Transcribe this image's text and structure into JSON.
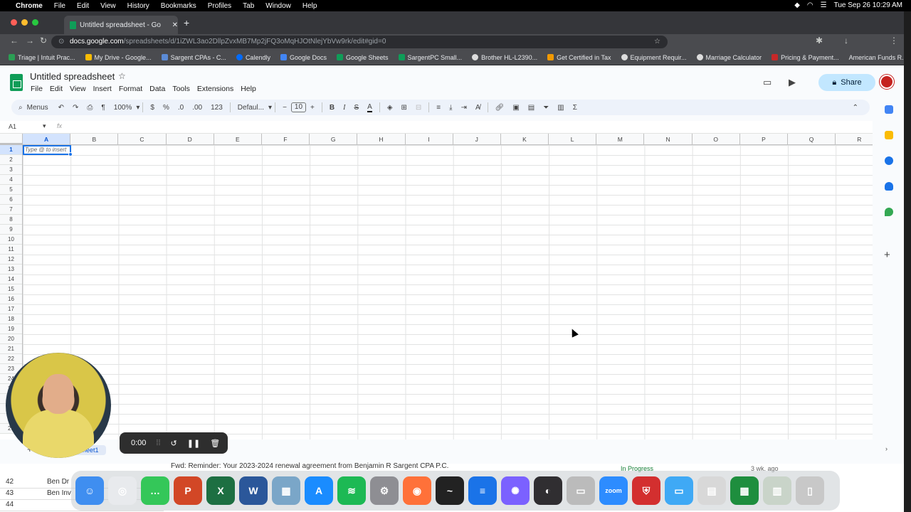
{
  "mac_menubar": {
    "app": "Chrome",
    "items": [
      "File",
      "Edit",
      "View",
      "History",
      "Bookmarks",
      "Profiles",
      "Tab",
      "Window",
      "Help"
    ],
    "clock": "Tue Sep 26  10:29 AM"
  },
  "browser": {
    "tab_title": "Untitled spreadsheet - Go",
    "url_host": "docs.google.com",
    "url_path": "/spreadsheets/d/1iZWL3ao2DllpZvxMB7Mp2jFQ3oMqHJOtNlejYbVw9rk/edit#gid=0",
    "bookmarks": [
      "Triage | Intuit Prac...",
      "My Drive - Google...",
      "Sargent CPAs - C...",
      "Calendly",
      "Google Docs",
      "Google Sheets",
      "SargentPC Small...",
      "Brother HL-L2390...",
      "Get Certified in Tax",
      "Equipment Requir...",
      "Marriage Calculator",
      "Pricing & Payment...",
      "American Funds R..."
    ]
  },
  "sheets": {
    "title": "Untitled spreadsheet",
    "menus": [
      "File",
      "Edit",
      "View",
      "Insert",
      "Format",
      "Data",
      "Tools",
      "Extensions",
      "Help"
    ],
    "share_label": "Share",
    "toolbar": {
      "menus_label": "Menus",
      "zoom": "100%",
      "currency": "$",
      "percent": "%",
      "dec_less": ".0",
      "dec_more": ".00",
      "number_format": "123",
      "font": "Defaul...",
      "font_size": "10"
    },
    "name_box": "A1",
    "fx": "fx",
    "columns": [
      "A",
      "B",
      "C",
      "D",
      "E",
      "F",
      "G",
      "H",
      "I",
      "J",
      "K",
      "L",
      "M",
      "N",
      "O",
      "P",
      "Q",
      "R"
    ],
    "rows": [
      "1",
      "2",
      "3",
      "4",
      "5",
      "6",
      "7",
      "8",
      "9",
      "10",
      "11",
      "12",
      "13",
      "14",
      "15",
      "16",
      "17",
      "18",
      "19",
      "20",
      "21",
      "22",
      "23",
      "24",
      "25",
      "26",
      "27",
      "28",
      "29"
    ],
    "a1_hint": "Type @ to insert",
    "sheet_tab": "Sheet1"
  },
  "background_app": {
    "rows": [
      {
        "num": "42",
        "name": "Ben Dr"
      },
      {
        "num": "43",
        "name": "Ben Inv"
      },
      {
        "num": "44",
        "name": ""
      }
    ],
    "email_subject": "Fwd: Reminder: Your 2023-2024 renewal agreement from Benjamin R Sargent CPA P.C.",
    "status": "In Progress",
    "age": "3 wk. ago"
  },
  "recorder": {
    "timer": "0:00"
  },
  "dock_apps": [
    "Finder",
    "Chrome",
    "Messages",
    "PowerPoint",
    "Excel",
    "Word",
    "Preview",
    "App Store",
    "Spotify",
    "System Settings",
    "Firefox",
    "Activity Monitor",
    "Docs",
    "Perplexity",
    "OBS",
    "Screenshot",
    "Zoom",
    "Bitwarden",
    "Folder",
    "Files",
    "Sheets doc",
    "Spreadsheet",
    "Trash"
  ]
}
